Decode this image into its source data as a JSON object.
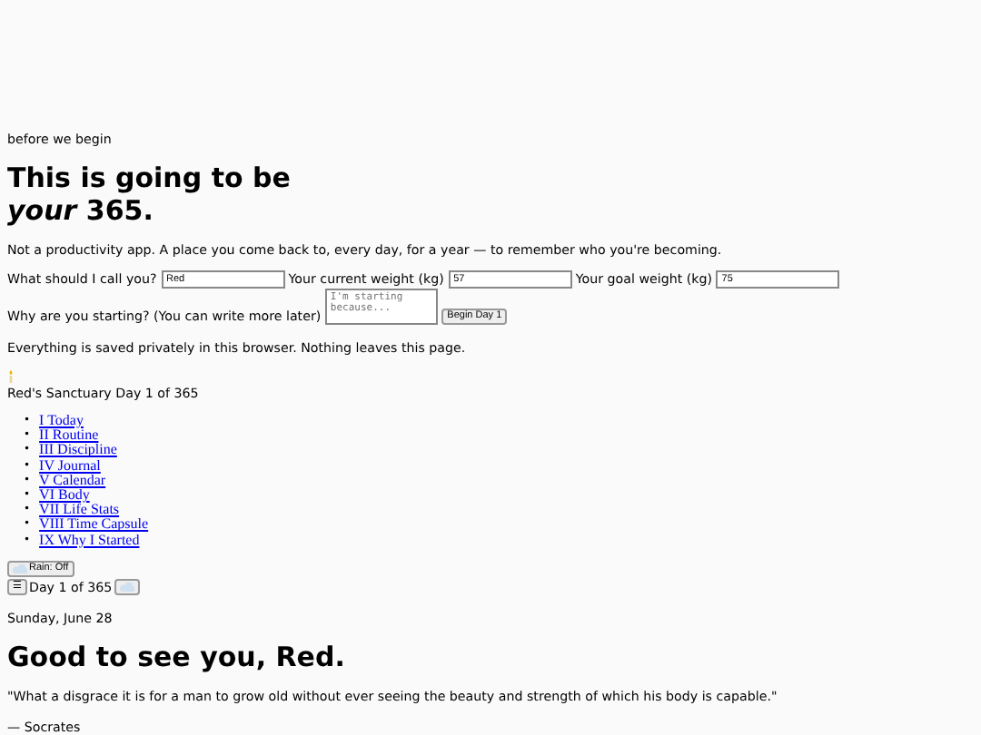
{
  "intro": {
    "eyebrow": "before we begin",
    "title_start": "This is going to be",
    "title_em": "your",
    "title_end": "365.",
    "subtitle": "Not a productivity app. A place you come back to, every day, for a year — to remember who you're becoming."
  },
  "form": {
    "fields": [
      {
        "label": "What should I call you?",
        "value": "Red"
      },
      {
        "label": "Your current weight (kg)",
        "value": "57"
      },
      {
        "label": "Your goal weight (kg)",
        "value": "75"
      }
    ],
    "why_label": "Why are you starting?",
    "why_placeholder": "I'm starting because...",
    "later_note": "(You can write more later)",
    "submit": "Begin Day 1",
    "privacy": "Everything is saved privately in this browser. Nothing leaves this page."
  },
  "header": {
    "brand": "Red's Sanctuary",
    "day": "Day 1 of 365"
  },
  "nav": [
    {
      "marker": "•",
      "label": "I Today"
    },
    {
      "marker": "•",
      "label": "II Routine"
    },
    {
      "marker": "•",
      "label": "III Discipline"
    },
    {
      "marker": "•",
      "label": "IV Journal"
    },
    {
      "marker": "•",
      "label": "V Calendar"
    },
    {
      "marker": "•",
      "label": "VI Body"
    },
    {
      "marker": "•",
      "label": "VII Life Stats"
    },
    {
      "marker": "•",
      "label": "VIII Time Capsule"
    },
    {
      "marker": "•",
      "label": "IX Why I Started"
    }
  ],
  "rain_button": "Rain: Off",
  "menu_button": "☰",
  "day_counter": "Day 1 of 365",
  "today": {
    "date": "Sunday, June 28",
    "greeting": "Good to see you, Red.",
    "quote": "\"What a disgrace it is for a man to grow old without ever seeing the beauty and strength of which his body is capable.\"",
    "author": "— Socrates"
  }
}
